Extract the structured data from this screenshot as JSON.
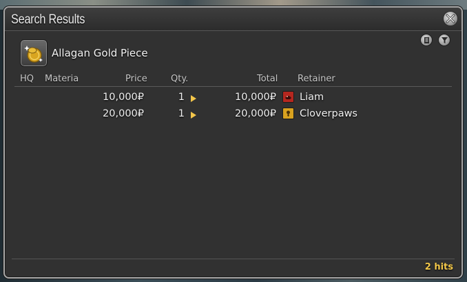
{
  "window": {
    "title": "Search Results",
    "close_icon": "close-icon",
    "toolbar_icons": [
      "list-icon",
      "filter-icon"
    ]
  },
  "item": {
    "name": "Allagan Gold Piece",
    "icon": "gold-coin-icon"
  },
  "columns": {
    "hq": "HQ",
    "materia": "Materia",
    "price": "Price",
    "qty": "Qty.",
    "total": "Total",
    "retainer": "Retainer"
  },
  "rows": [
    {
      "price": "10,000₽",
      "qty": "1",
      "total": "10,000₽",
      "retainer": "Liam",
      "retainer_icon": "red-retainer-icon",
      "icon_color": "#b5271f"
    },
    {
      "price": "20,000₽",
      "qty": "1",
      "total": "20,000₽",
      "retainer": "Cloverpaws",
      "retainer_icon": "gold-retainer-icon",
      "icon_color": "#d9a21f"
    }
  ],
  "footer": {
    "hits": "2 hits"
  },
  "colors": {
    "accent": "#f3c84a",
    "window_bg": "#313131",
    "border": "#a9a9a9"
  }
}
